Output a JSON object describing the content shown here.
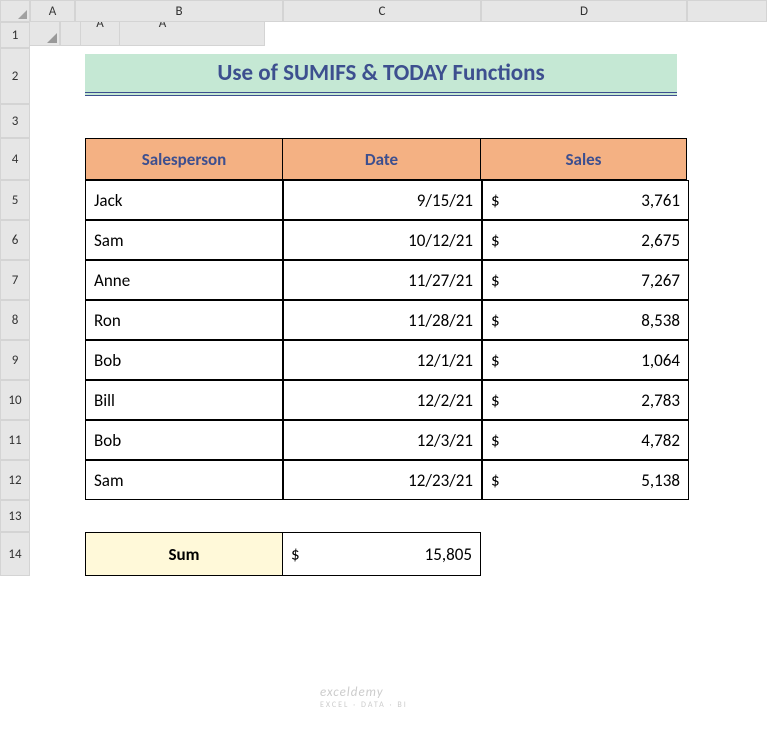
{
  "columns": [
    "A",
    "B",
    "C",
    "D"
  ],
  "rows": [
    "1",
    "2",
    "3",
    "4",
    "5",
    "6",
    "7",
    "8",
    "9",
    "10",
    "11",
    "12",
    "13",
    "14"
  ],
  "title": "Use of SUMIFS & TODAY Functions",
  "headers": {
    "salesperson": "Salesperson",
    "date": "Date",
    "sales": "Sales"
  },
  "data": [
    {
      "name": "Jack",
      "date": "9/15/21",
      "currency": "$",
      "sales": "3,761"
    },
    {
      "name": "Sam",
      "date": "10/12/21",
      "currency": "$",
      "sales": "2,675"
    },
    {
      "name": "Anne",
      "date": "11/27/21",
      "currency": "$",
      "sales": "7,267"
    },
    {
      "name": "Ron",
      "date": "11/28/21",
      "currency": "$",
      "sales": "8,538"
    },
    {
      "name": "Bob",
      "date": "12/1/21",
      "currency": "$",
      "sales": "1,064"
    },
    {
      "name": "Bill",
      "date": "12/2/21",
      "currency": "$",
      "sales": "2,783"
    },
    {
      "name": "Bob",
      "date": "12/3/21",
      "currency": "$",
      "sales": "4,782"
    },
    {
      "name": "Sam",
      "date": "12/23/21",
      "currency": "$",
      "sales": "5,138"
    }
  ],
  "sum": {
    "label": "Sum",
    "currency": "$",
    "value": "15,805"
  },
  "watermark": {
    "main": "exceldemy",
    "sub": "EXCEL · DATA · BI"
  }
}
